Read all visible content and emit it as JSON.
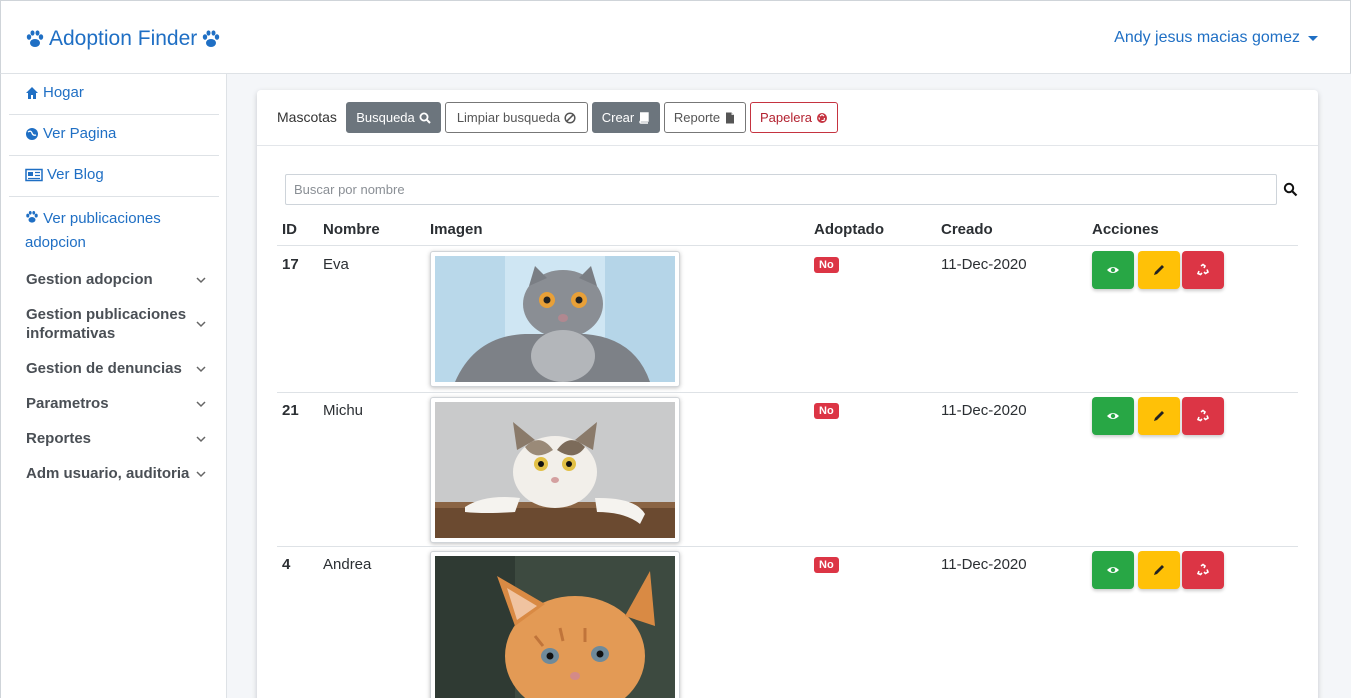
{
  "header": {
    "brand": "Adoption Finder",
    "user": "Andy jesus macias gomez"
  },
  "sidebar": {
    "links": [
      {
        "label": "Hogar",
        "icon": "home-icon"
      },
      {
        "label": "Ver Pagina",
        "icon": "globe-icon"
      },
      {
        "label": "Ver Blog",
        "icon": "newspaper-icon"
      },
      {
        "label": "Ver publicaciones adopcion",
        "icon": "paw-icon"
      }
    ],
    "groups": [
      "Gestion adopcion",
      "Gestion publicaciones informativas",
      "Gestion de denuncias",
      "Parametros",
      "Reportes",
      "Adm usuario, auditoria"
    ]
  },
  "toolbar": {
    "title": "Mascotas",
    "busqueda": "Busqueda",
    "limpiar": "Limpiar busqueda",
    "crear": "Crear",
    "reporte": "Reporte",
    "papelera": "Papelera"
  },
  "search": {
    "placeholder": "Buscar por nombre"
  },
  "table": {
    "columns": [
      "ID",
      "Nombre",
      "Imagen",
      "Adoptado",
      "Creado",
      "Acciones"
    ],
    "rows": [
      {
        "id": "17",
        "name": "Eva",
        "adopted": "No",
        "created": "11-Dec-2020",
        "image": "gray-cat-photo"
      },
      {
        "id": "21",
        "name": "Michu",
        "adopted": "No",
        "created": "11-Dec-2020",
        "image": "calico-cat-photo"
      },
      {
        "id": "4",
        "name": "Andrea",
        "adopted": "No",
        "created": "11-Dec-2020",
        "image": "orange-kitten-photo"
      }
    ]
  },
  "colors": {
    "brand": "#1f6fc4",
    "view": "#28a745",
    "edit": "#ffc107",
    "delete": "#dc3545"
  }
}
